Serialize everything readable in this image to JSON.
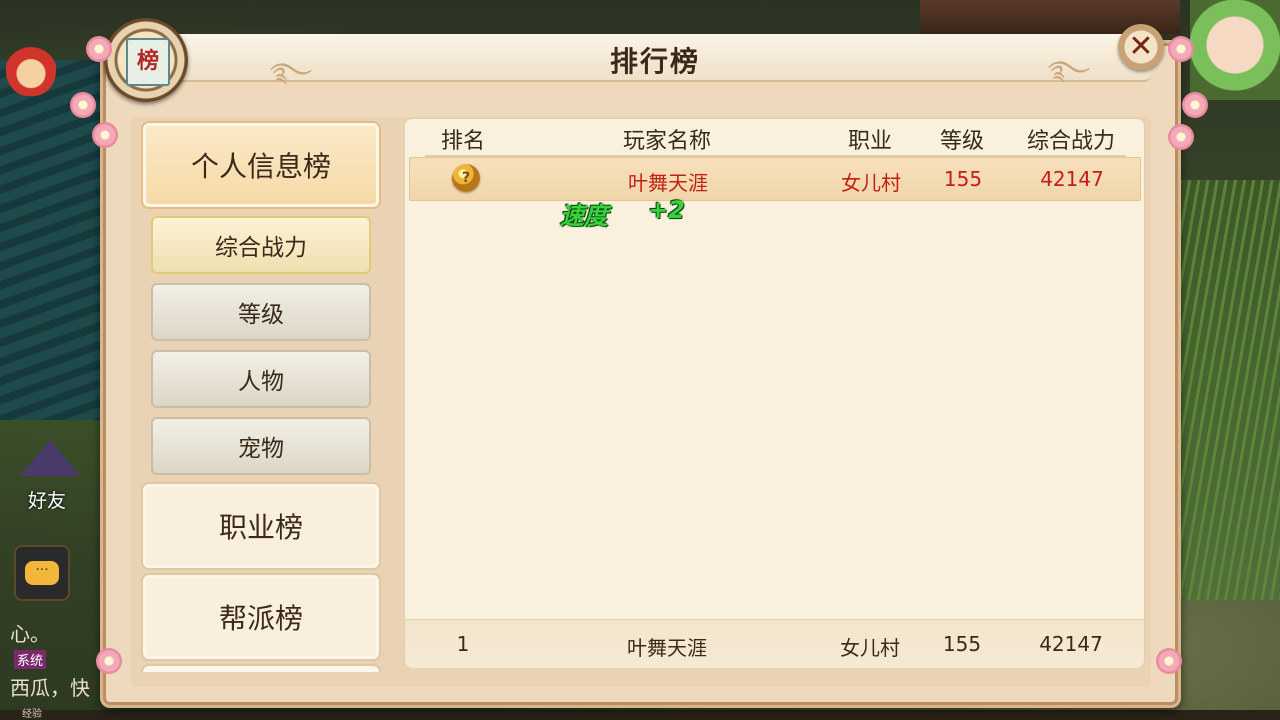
{
  "panel": {
    "title": "排行榜",
    "emblem_text": "榜",
    "close_label": "✕"
  },
  "nav": {
    "categories": [
      {
        "label": "个人信息榜",
        "active": true
      },
      {
        "label": "职业榜",
        "active": false
      },
      {
        "label": "帮派榜",
        "active": false
      }
    ],
    "sub_items": [
      {
        "label": "综合战力",
        "selected": true
      },
      {
        "label": "等级",
        "selected": false
      },
      {
        "label": "人物",
        "selected": false
      },
      {
        "label": "宠物",
        "selected": false
      }
    ]
  },
  "table": {
    "headers": [
      "排名",
      "玩家名称",
      "职业",
      "等级",
      "综合战力"
    ],
    "rows": [
      {
        "rank_icon": "gold-medal-icon",
        "rank_text": "?",
        "name": "叶舞天涯",
        "job": "女儿村",
        "level": "155",
        "power": "42147"
      }
    ],
    "my_rank": {
      "rank": "1",
      "name": "叶舞天涯",
      "job": "女儿村",
      "level": "155",
      "power": "42147"
    },
    "highlight_color": "#c41f14"
  },
  "buff_popup": {
    "label": "速度",
    "value": "+2"
  },
  "hud": {
    "friend_label": "好友",
    "chat_icon": "chat-bubble-icon",
    "chat_lines": [
      "心。",
      "西瓜，快"
    ],
    "chat_tag": "系统",
    "exp_label": "经验"
  }
}
